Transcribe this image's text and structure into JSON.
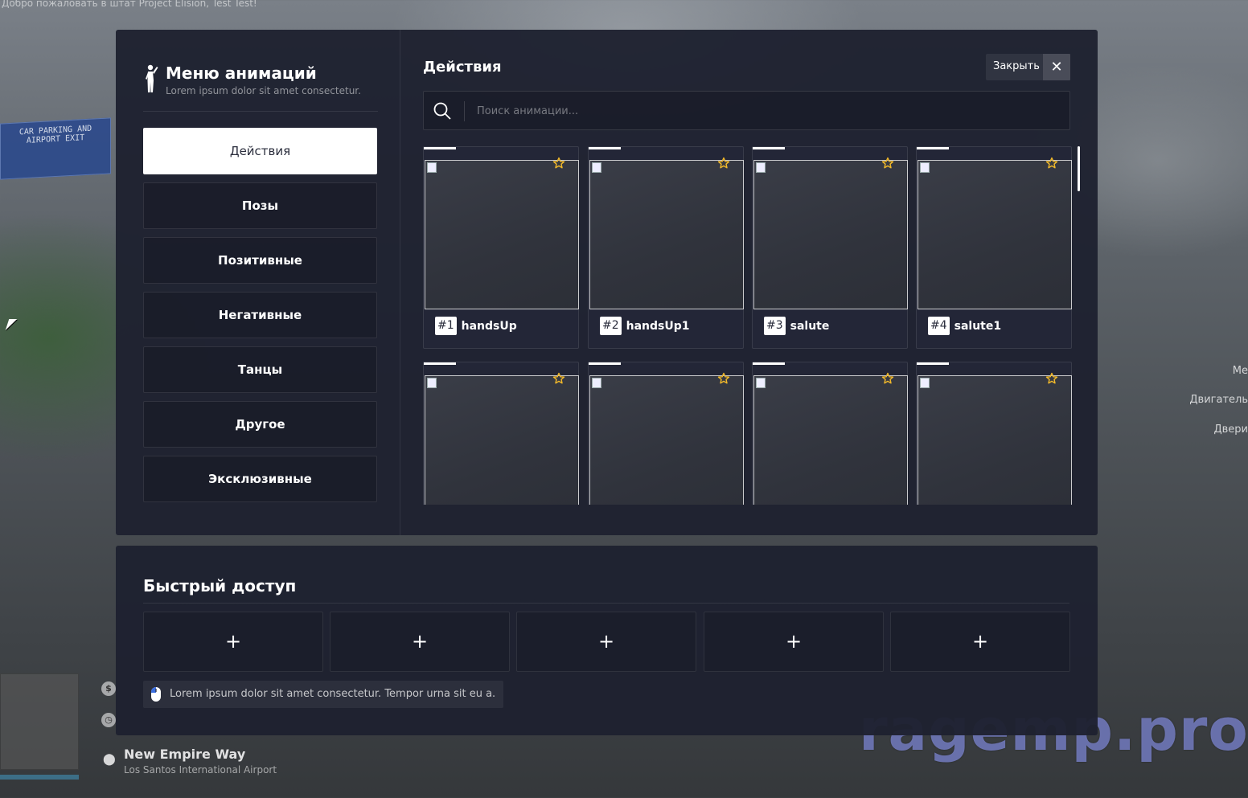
{
  "background": {
    "top_text": "Добро пожаловать в штат Project Elision, Test Test!",
    "sign_text": "CAR PARKING AND AIRPORT EXIT",
    "right_labels": [
      "Ме",
      "Двигатель",
      "Двери"
    ],
    "location": {
      "street": "New Empire Way",
      "area": "Los Santos International Airport"
    },
    "watermark": "ragemp.pro"
  },
  "menu": {
    "title": "Меню анимаций",
    "subtitle": "Lorem ipsum dolor sit amet consectetur.",
    "categories": [
      {
        "label": "Действия",
        "active": true
      },
      {
        "label": "Позы",
        "active": false
      },
      {
        "label": "Позитивные",
        "active": false
      },
      {
        "label": "Негативные",
        "active": false
      },
      {
        "label": "Танцы",
        "active": false
      },
      {
        "label": "Другое",
        "active": false
      },
      {
        "label": "Эксклюзивные",
        "active": false
      }
    ]
  },
  "content": {
    "title": "Действия",
    "close_label": "Закрыть",
    "search_placeholder": "Поиск анимации...",
    "animations": [
      {
        "num": "#1",
        "name": "handsUp"
      },
      {
        "num": "#2",
        "name": "handsUp1"
      },
      {
        "num": "#3",
        "name": "salute"
      },
      {
        "num": "#4",
        "name": "salute1"
      },
      {
        "num": "",
        "name": ""
      },
      {
        "num": "",
        "name": ""
      },
      {
        "num": "",
        "name": ""
      },
      {
        "num": "",
        "name": ""
      }
    ]
  },
  "quick_access": {
    "title": "Быстрый доступ",
    "slots": [
      "+",
      "+",
      "+",
      "+",
      "+"
    ],
    "hint": "Lorem ipsum dolor sit amet consectetur. Tempor urna sit eu a."
  },
  "colors": {
    "panel": "#1e2130",
    "star": "#f2b92a",
    "accent_white": "#ffffff"
  }
}
